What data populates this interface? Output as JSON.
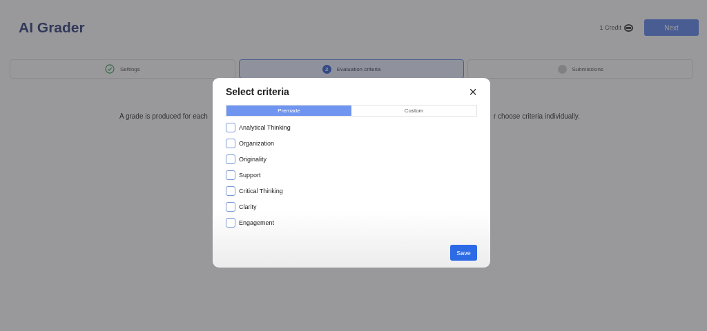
{
  "header": {
    "title": "AI Grader",
    "credits": "1 Credit",
    "next_button": "Next"
  },
  "steps": [
    {
      "label": "Settings",
      "kind": "done",
      "selected": false
    },
    {
      "number": "2",
      "label": "Evaluation criteria",
      "kind": "current",
      "selected": true
    },
    {
      "label": "Submissions",
      "kind": "pending",
      "selected": false
    }
  ],
  "description": {
    "visible_start": "A grade is produced for each",
    "visible_end": "r choose criteria individually."
  },
  "dialog": {
    "title": "Select criteria",
    "close": "×",
    "tabs": [
      {
        "label": "Premade",
        "selected": true
      },
      {
        "label": "Custom",
        "selected": false
      }
    ],
    "criteria": [
      {
        "label": "Analytical Thinking",
        "checked": false
      },
      {
        "label": "Organization",
        "checked": false
      },
      {
        "label": "Originality",
        "checked": false
      },
      {
        "label": "Support",
        "checked": false
      },
      {
        "label": "Critical Thinking",
        "checked": false
      },
      {
        "label": "Clarity",
        "checked": false
      },
      {
        "label": "Engagement",
        "checked": false
      }
    ],
    "save_button": "Save"
  }
}
